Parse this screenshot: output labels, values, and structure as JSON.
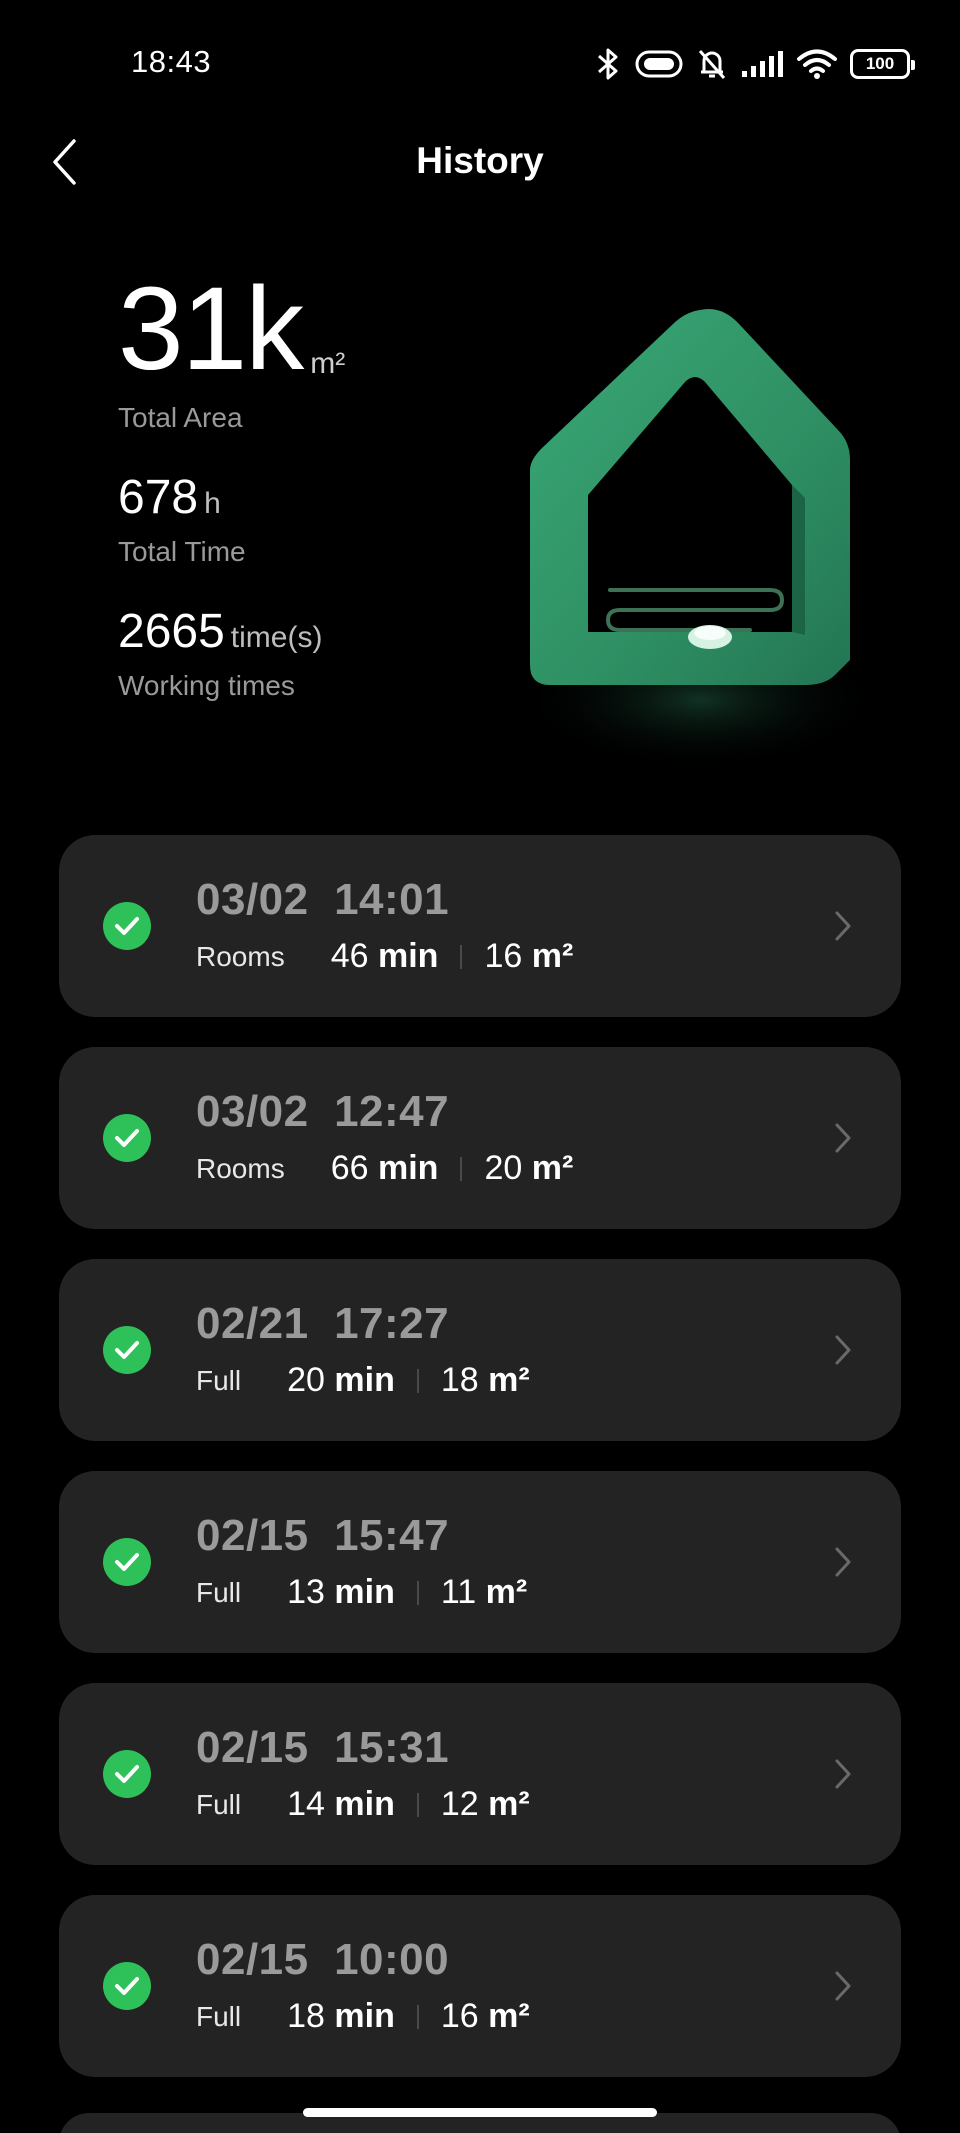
{
  "status_bar": {
    "time": "18:43",
    "battery": "100",
    "icons": [
      "bluetooth-icon",
      "vibrate-icon",
      "silent-bell-icon",
      "signal-icon",
      "wifi-icon",
      "battery-icon"
    ]
  },
  "header": {
    "title": "History",
    "back_icon": "chevron-left-icon"
  },
  "stats": {
    "total_area": {
      "value": "31k",
      "unit": "m²",
      "label": "Total Area"
    },
    "total_time": {
      "value": "678",
      "unit": "h",
      "label": "Total Time"
    },
    "working_times": {
      "value": "2665",
      "unit": "time(s)",
      "label": "Working times"
    }
  },
  "colors": {
    "background": "#000000",
    "card": "#232323",
    "success": "#2fc159",
    "muted_text": "#9a9a9a",
    "illustration_green": "#2f9a68"
  },
  "records": [
    {
      "date": "03/02",
      "time": "14:01",
      "mode": "Rooms",
      "duration": "46",
      "duration_unit": "min",
      "area": "16",
      "area_unit": "m²"
    },
    {
      "date": "03/02",
      "time": "12:47",
      "mode": "Rooms",
      "duration": "66",
      "duration_unit": "min",
      "area": "20",
      "area_unit": "m²"
    },
    {
      "date": "02/21",
      "time": "17:27",
      "mode": "Full",
      "duration": "20",
      "duration_unit": "min",
      "area": "18",
      "area_unit": "m²"
    },
    {
      "date": "02/15",
      "time": "15:47",
      "mode": "Full",
      "duration": "13",
      "duration_unit": "min",
      "area": "11",
      "area_unit": "m²"
    },
    {
      "date": "02/15",
      "time": "15:31",
      "mode": "Full",
      "duration": "14",
      "duration_unit": "min",
      "area": "12",
      "area_unit": "m²"
    },
    {
      "date": "02/15",
      "time": "10:00",
      "mode": "Full",
      "duration": "18",
      "duration_unit": "min",
      "area": "16",
      "area_unit": "m²"
    }
  ]
}
